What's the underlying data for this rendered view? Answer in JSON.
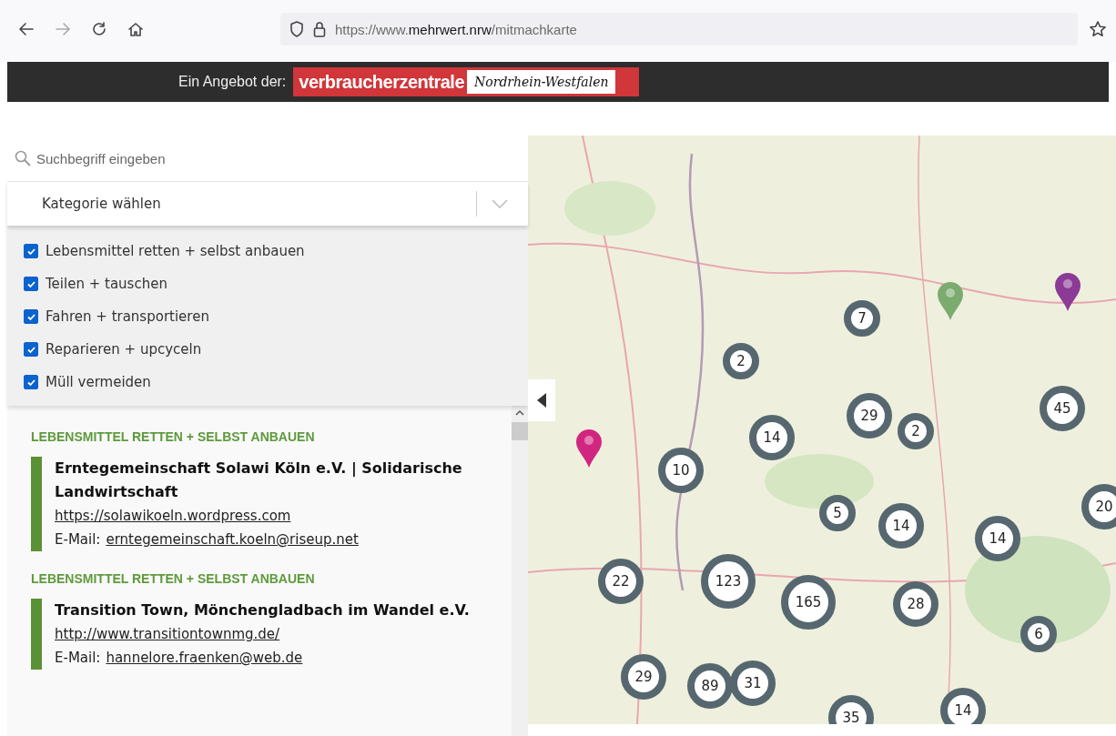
{
  "browser": {
    "url_prefix": "https://www.",
    "url_domain": "mehrwert.nrw",
    "url_path": "/mitmachkarte"
  },
  "header": {
    "offer_label": "Ein Angebot der:",
    "logo_main": "verbraucherzentrale",
    "logo_region": "Nordrhein-Westfalen"
  },
  "search": {
    "placeholder": "Suchbegriff eingeben"
  },
  "category_select": {
    "placeholder": "Kategorie wählen"
  },
  "categories": [
    {
      "label": "Lebensmittel retten + selbst anbauen",
      "checked": true
    },
    {
      "label": "Teilen + tauschen",
      "checked": true
    },
    {
      "label": "Fahren + transportieren",
      "checked": true
    },
    {
      "label": "Reparieren + upcyceln",
      "checked": true
    },
    {
      "label": "Müll vermeiden",
      "checked": true
    }
  ],
  "results": [
    {
      "category": "LEBENSMITTEL RETTEN + SELBST ANBAUEN",
      "name": "Erntegemeinschaft Solawi Köln e.V. | Solidarische Landwirtschaft",
      "url": "https://solawikoeln.wordpress.com",
      "email_label": "E-Mail:",
      "email": "erntegemeinschaft.koeln@riseup.net"
    },
    {
      "category": "LEBENSMITTEL RETTEN + SELBST ANBAUEN",
      "name": "Transition Town, Mönchengladbach im Wandel e.V.",
      "url": "http://www.transitiontownmg.de/",
      "email_label": "E-Mail:",
      "email": "hannelore.fraenken@web.de"
    }
  ],
  "map": {
    "clusters": [
      {
        "count": "7"
      },
      {
        "count": "2"
      },
      {
        "count": "29"
      },
      {
        "count": "2"
      },
      {
        "count": "45"
      },
      {
        "count": "14"
      },
      {
        "count": "10"
      },
      {
        "count": "5"
      },
      {
        "count": "14"
      },
      {
        "count": "14"
      },
      {
        "count": "22"
      },
      {
        "count": "123"
      },
      {
        "count": "165"
      },
      {
        "count": "28"
      },
      {
        "count": "6"
      },
      {
        "count": "29"
      },
      {
        "count": "89"
      },
      {
        "count": "31"
      },
      {
        "count": "20"
      },
      {
        "count": "35"
      },
      {
        "count": "14"
      }
    ],
    "pins": [
      {
        "color": "#7bab6e"
      },
      {
        "color": "#8b3a96"
      },
      {
        "color": "#d0267f"
      }
    ]
  }
}
